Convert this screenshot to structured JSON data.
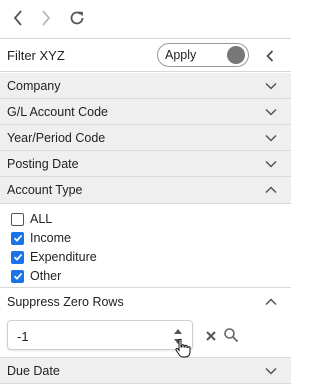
{
  "toolbar": {
    "back_icon": "chevron-left-icon",
    "forward_icon": "chevron-right-icon",
    "refresh_icon": "refresh-icon"
  },
  "filter": {
    "title": "Filter XYZ",
    "apply_label": "Apply",
    "collapse_icon": "chevron-left-icon"
  },
  "sections": {
    "company": "Company",
    "gl_account_code": "G/L Account Code",
    "year_period_code": "Year/Period Code",
    "posting_date": "Posting Date",
    "account_type": "Account Type",
    "suppress_zero_rows": "Suppress Zero Rows",
    "due_date": "Due Date"
  },
  "account_type": {
    "options": [
      {
        "label": "ALL",
        "checked": false
      },
      {
        "label": "Income",
        "checked": true
      },
      {
        "label": "Expenditure",
        "checked": true
      },
      {
        "label": "Other",
        "checked": true
      }
    ]
  },
  "suppress_zero_rows": {
    "value": "-1"
  },
  "colors": {
    "checkbox_checked": "#1a73e8",
    "section_bg": "#efefef",
    "toggle_knob": "#777777"
  }
}
